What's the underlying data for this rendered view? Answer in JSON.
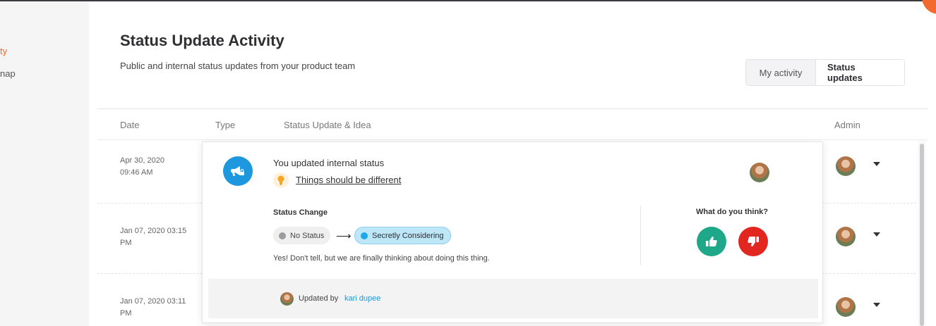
{
  "sidebar": {
    "items": [
      {
        "label": "ty"
      },
      {
        "label": "nap"
      }
    ]
  },
  "header": {
    "title": "Status Update Activity",
    "subtitle": "Public and internal status updates from your product team"
  },
  "toggle": {
    "options": [
      {
        "label": "My activity"
      },
      {
        "label": "Status updates"
      }
    ]
  },
  "table": {
    "columns": [
      "Date",
      "Type",
      "Status Update & Idea",
      "Admin"
    ],
    "rows": [
      {
        "date_line1": "Apr 30, 2020",
        "date_line2": "09:46 AM"
      },
      {
        "date_line1": "Jan 07, 2020 03:15",
        "date_line2": "PM"
      },
      {
        "date_line1": "Jan 07, 2020 03:11",
        "date_line2": "PM"
      }
    ]
  },
  "card": {
    "heading": "You updated internal status",
    "idea_title": "Things should be different",
    "status_change_label": "Status Change",
    "from_status": "No Status",
    "to_status": "Secretly Considering",
    "arrow": "⟶",
    "message": "Yes! Don't tell, but we are finally thinking about doing this thing.",
    "vote_prompt": "What do you think?",
    "updated_by_prefix": "Updated by",
    "updated_by_user": "kari dupee"
  },
  "colors": {
    "accent": "#f26a2e",
    "brand_blue": "#1d97de",
    "thumbs_up": "#1ea889",
    "thumbs_down": "#e1271f",
    "status_pill": "#bde6f7"
  }
}
